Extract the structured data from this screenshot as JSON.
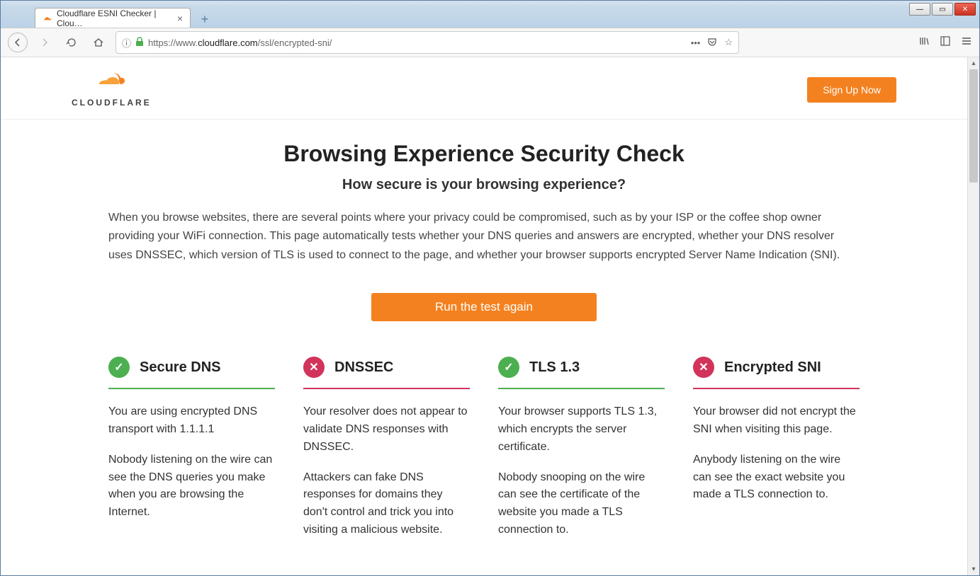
{
  "browser": {
    "tab_title": "Cloudflare ESNI Checker | Clou…",
    "url_prefix": "https://www.",
    "url_domain": "cloudflare.com",
    "url_path": "/ssl/encrypted-sni/"
  },
  "header": {
    "logo_text": "CLOUDFLARE",
    "signup_label": "Sign Up Now"
  },
  "page": {
    "title": "Browsing Experience Security Check",
    "subtitle": "How secure is your browsing experience?",
    "intro": "When you browse websites, there are several points where your privacy could be compromised, such as by your ISP or the coffee shop owner providing your WiFi connection. This page automatically tests whether your DNS queries and answers are encrypted, whether your DNS resolver uses DNSSEC, which version of TLS is used to connect to the page, and whether your browser supports encrypted Server Name Indication (SNI).",
    "run_button": "Run the test again"
  },
  "results": [
    {
      "status": "pass",
      "title": "Secure DNS",
      "summary": "You are using encrypted DNS transport with 1.1.1.1",
      "detail": "Nobody listening on the wire can see the DNS queries you make when you are browsing the Internet."
    },
    {
      "status": "fail",
      "title": "DNSSEC",
      "summary": "Your resolver does not appear to validate DNS responses with DNSSEC.",
      "detail": "Attackers can fake DNS responses for domains they don't control and trick you into visiting a malicious website."
    },
    {
      "status": "pass",
      "title": "TLS 1.3",
      "summary": "Your browser supports TLS 1.3, which encrypts the server certificate.",
      "detail": "Nobody snooping on the wire can see the certificate of the website you made a TLS connection to."
    },
    {
      "status": "fail",
      "title": "Encrypted SNI",
      "summary": "Your browser did not encrypt the SNI when visiting this page.",
      "detail": "Anybody listening on the wire can see the exact website you made a TLS connection to."
    }
  ]
}
